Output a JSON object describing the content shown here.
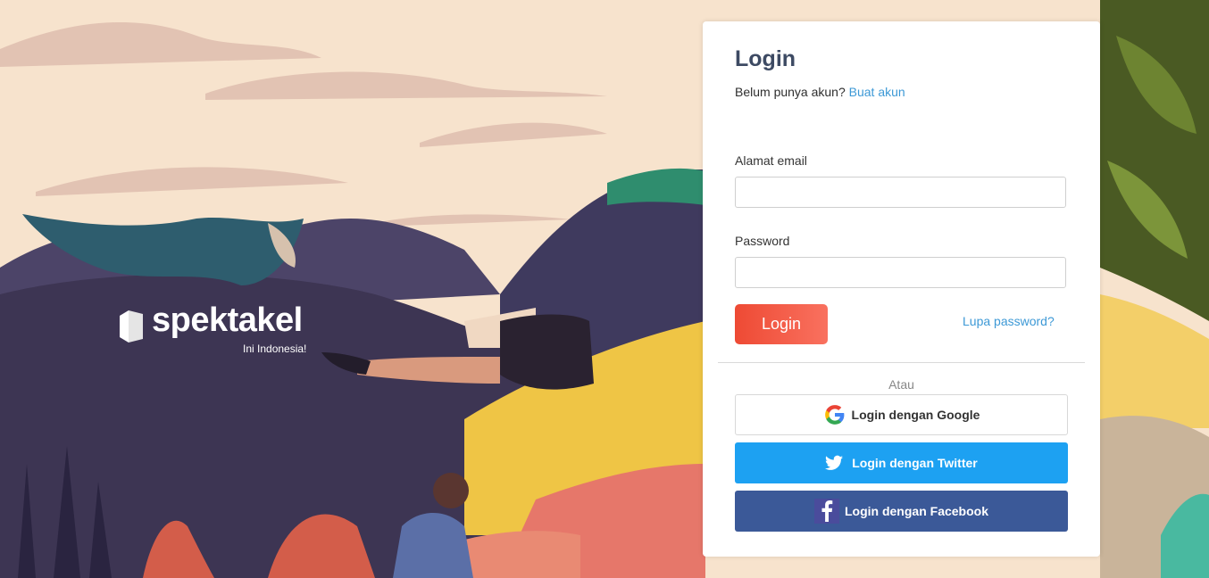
{
  "brand": {
    "name": "spektakel",
    "tagline": "Ini Indonesia!"
  },
  "login": {
    "title": "Login",
    "no_account_text": "Belum punya akun? ",
    "signup_link": "Buat akun",
    "email_label": "Alamat email",
    "email_value": "",
    "password_label": "Password",
    "password_value": "",
    "submit_label": "Login",
    "forgot_link": "Lupa password?",
    "or_text": "Atau",
    "google_label": "Login dengan Google",
    "twitter_label": "Login dengan Twitter",
    "facebook_label": "Login dengan Facebook"
  },
  "colors": {
    "primary_red": "#ee4a34",
    "link_blue": "#3d99d6",
    "twitter_blue": "#1da1f2",
    "facebook_blue": "#3b5998",
    "title": "#3d4a63"
  }
}
